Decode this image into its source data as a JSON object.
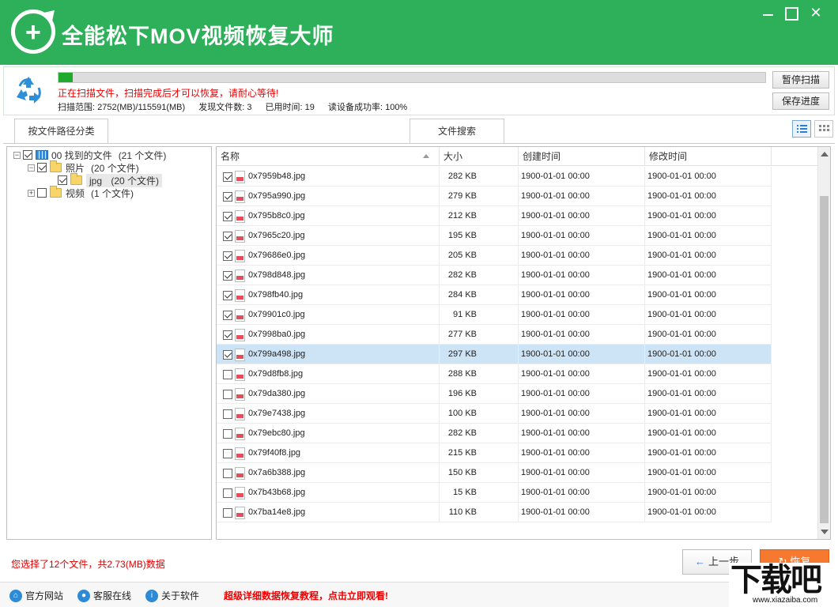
{
  "app": {
    "title": "全能松下MOV视频恢复大师",
    "window_controls": {
      "minimize": "",
      "maximize": "",
      "close": "✕"
    }
  },
  "scan": {
    "progress": 0.02,
    "message": "正在扫描文件，扫描完成后才可以恢复，请耐心等待!",
    "stats": {
      "range": "扫描范围: 2752(MB)/115591(MB)",
      "found": "发现文件数: 3",
      "elapsed": "已用时间: 19",
      "success_rate": "读设备成功率: 100%"
    },
    "pause_label": "暂停扫描",
    "save_label": "保存进度"
  },
  "tabs": [
    {
      "label": "按文件路径分类",
      "active": true
    },
    {
      "label": "文件搜索",
      "active": false
    }
  ],
  "view_modes": {
    "list": "list-view-icon",
    "grid": "grid-view-icon"
  },
  "tree": {
    "root": {
      "expander": "−",
      "label": "00 找到的文件",
      "count": "(21 个文件)",
      "checked": true
    },
    "photos": {
      "expander": "−",
      "label": "照片",
      "count": "(20 个文件)",
      "checked": true
    },
    "jpg": {
      "label": "jpg",
      "count": "(20 个文件)",
      "checked": true
    },
    "videos": {
      "expander": "+",
      "label": "视频",
      "count": "(1 个文件)",
      "checked": false
    }
  },
  "grid": {
    "columns": {
      "name": "名称",
      "size": "大小",
      "created": "创建时间",
      "modified": "修改时间"
    },
    "rows": [
      {
        "checked": true,
        "name": "0x7959b48.jpg",
        "size": "282 KB",
        "created": "1900-01-01  00:00",
        "modified": "1900-01-01  00:00"
      },
      {
        "checked": true,
        "name": "0x795a990.jpg",
        "size": "279 KB",
        "created": "1900-01-01  00:00",
        "modified": "1900-01-01  00:00"
      },
      {
        "checked": true,
        "name": "0x795b8c0.jpg",
        "size": "212 KB",
        "created": "1900-01-01  00:00",
        "modified": "1900-01-01  00:00"
      },
      {
        "checked": true,
        "name": "0x7965c20.jpg",
        "size": "195 KB",
        "created": "1900-01-01  00:00",
        "modified": "1900-01-01  00:00"
      },
      {
        "checked": true,
        "name": "0x79686e0.jpg",
        "size": "205 KB",
        "created": "1900-01-01  00:00",
        "modified": "1900-01-01  00:00"
      },
      {
        "checked": true,
        "name": "0x798d848.jpg",
        "size": "282 KB",
        "created": "1900-01-01  00:00",
        "modified": "1900-01-01  00:00"
      },
      {
        "checked": true,
        "name": "0x798fb40.jpg",
        "size": "284 KB",
        "created": "1900-01-01  00:00",
        "modified": "1900-01-01  00:00"
      },
      {
        "checked": true,
        "name": "0x79901c0.jpg",
        "size": "91 KB",
        "created": "1900-01-01  00:00",
        "modified": "1900-01-01  00:00"
      },
      {
        "checked": true,
        "name": "0x7998ba0.jpg",
        "size": "277 KB",
        "created": "1900-01-01  00:00",
        "modified": "1900-01-01  00:00"
      },
      {
        "checked": true,
        "name": "0x799a498.jpg",
        "size": "297 KB",
        "created": "1900-01-01  00:00",
        "modified": "1900-01-01  00:00",
        "selected": true
      },
      {
        "checked": false,
        "name": "0x79d8fb8.jpg",
        "size": "288 KB",
        "created": "1900-01-01  00:00",
        "modified": "1900-01-01  00:00"
      },
      {
        "checked": false,
        "name": "0x79da380.jpg",
        "size": "196 KB",
        "created": "1900-01-01  00:00",
        "modified": "1900-01-01  00:00"
      },
      {
        "checked": false,
        "name": "0x79e7438.jpg",
        "size": "100 KB",
        "created": "1900-01-01  00:00",
        "modified": "1900-01-01  00:00"
      },
      {
        "checked": false,
        "name": "0x79ebc80.jpg",
        "size": "282 KB",
        "created": "1900-01-01  00:00",
        "modified": "1900-01-01  00:00"
      },
      {
        "checked": false,
        "name": "0x79f40f8.jpg",
        "size": "215 KB",
        "created": "1900-01-01  00:00",
        "modified": "1900-01-01  00:00"
      },
      {
        "checked": false,
        "name": "0x7a6b388.jpg",
        "size": "150 KB",
        "created": "1900-01-01  00:00",
        "modified": "1900-01-01  00:00"
      },
      {
        "checked": false,
        "name": "0x7b43b68.jpg",
        "size": "15 KB",
        "created": "1900-01-01  00:00",
        "modified": "1900-01-01  00:00"
      },
      {
        "checked": false,
        "name": "0x7ba14e8.jpg",
        "size": "110 KB",
        "created": "1900-01-01  00:00",
        "modified": "1900-01-01  00:00"
      }
    ]
  },
  "status": {
    "selection_text": "您选择了12个文件，共2.73(MB)数据",
    "prev_label": "上一步",
    "recover_label": "恢复"
  },
  "footer": {
    "website": "官方网站",
    "support": "客服在线",
    "about": "关于软件",
    "promo": "超级详细数据恢复教程，点击立即观看!"
  },
  "watermark": {
    "big": "下载吧",
    "small": "www.xiazaiba.com"
  },
  "colors": {
    "brand": "#2eb05a",
    "alert": "#e00000",
    "recover": "#f6792f",
    "selected_row": "#cde3f6",
    "progress": "#1eaa2c"
  }
}
